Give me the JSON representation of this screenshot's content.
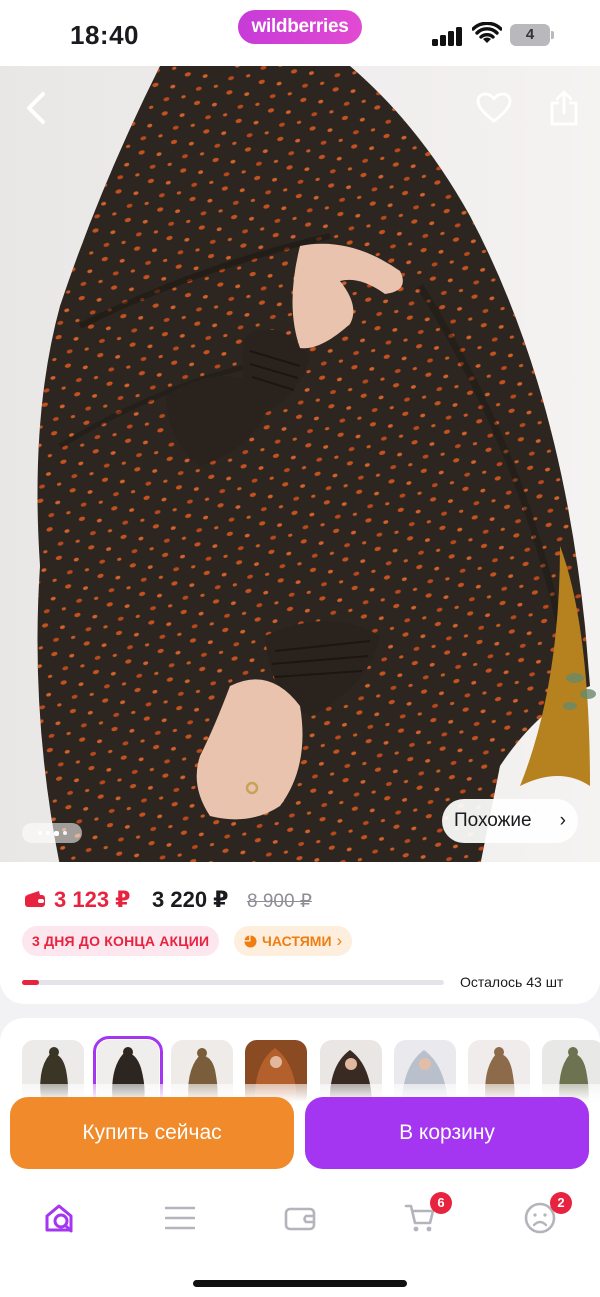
{
  "status_bar": {
    "time": "18:40",
    "brand": "wildberries",
    "battery": "4"
  },
  "hero": {
    "icons": [
      "chevron-left-icon",
      "heart-icon",
      "share-icon"
    ],
    "gallery_dots": 4,
    "gallery_active_index": 2,
    "similar_label": "Похожие",
    "similar_chevron": "›"
  },
  "price": {
    "wallet_price": "3 123 ₽",
    "price": "3 220 ₽",
    "old_price": "8 900 ₽",
    "promo_badge": "3 ДНЯ ДО КОНЦА АКЦИИ",
    "installments_badge": "ЧАСТЯМИ",
    "installments_chevron": "›",
    "stock_progress": 0.04,
    "stock_text": "Осталось 43 шт"
  },
  "variants": {
    "count": 8,
    "selected_index": 1
  },
  "actions": {
    "buy_now": "Купить сейчас",
    "add_to_cart": "В корзину"
  },
  "bottom_nav": {
    "items": [
      "home-search-icon",
      "catalog-icon",
      "wallet-icon",
      "cart-icon",
      "profile-icon"
    ],
    "cart_badge": "6",
    "profile_badge": "2"
  },
  "colors": {
    "accent_purple": "#a435f0",
    "accent_orange": "#f08a2a",
    "price_red": "#e8233f",
    "brand_pink": "#e24ad2"
  }
}
